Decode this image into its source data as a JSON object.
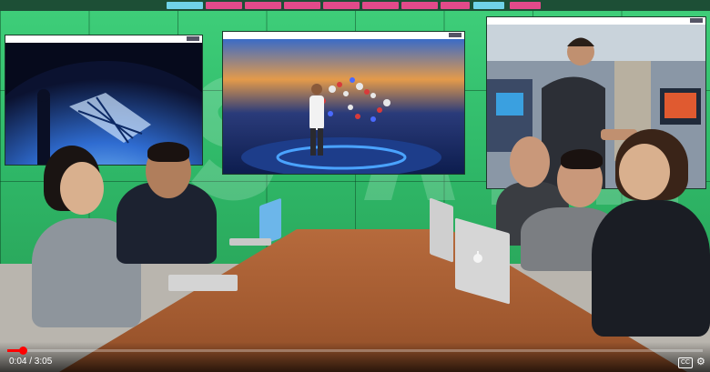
{
  "video": {
    "current_time": "0:04",
    "duration": "3:05",
    "time_label": "0:04 / 3:05",
    "progress": 0.0216,
    "cc_label": "CC",
    "settings_icon": "gear-icon"
  },
  "colors": {
    "wall_green": "#34c070",
    "progress_red": "#ff0000",
    "table_wood": "#a85e33"
  }
}
